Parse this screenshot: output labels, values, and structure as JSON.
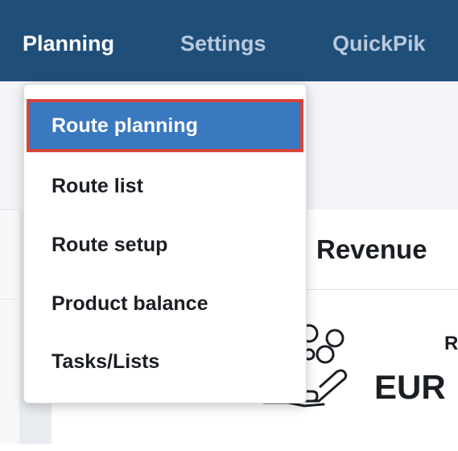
{
  "navbar": {
    "items": [
      {
        "label": "Planning",
        "active": true
      },
      {
        "label": "Settings",
        "active": false
      },
      {
        "label": "QuickPik",
        "active": false
      }
    ]
  },
  "dropdown": {
    "items": [
      {
        "label": "Route planning",
        "selected": true
      },
      {
        "label": "Route list"
      },
      {
        "label": "Route setup"
      },
      {
        "label": "Product balance"
      },
      {
        "label": "Tasks/Lists"
      }
    ]
  },
  "card": {
    "title_fragment": "Revenue",
    "label_fragment": "R",
    "currency_fragment": "EUR"
  },
  "colors": {
    "navbar_bg": "#1f4e79",
    "nav_active_text": "#ffffff",
    "nav_inactive_text": "#b9c9dc",
    "menu_selected_bg": "#3a78c0",
    "selection_outline": "#d8453a"
  },
  "icons": {
    "revenue": "money-hand-icon"
  }
}
